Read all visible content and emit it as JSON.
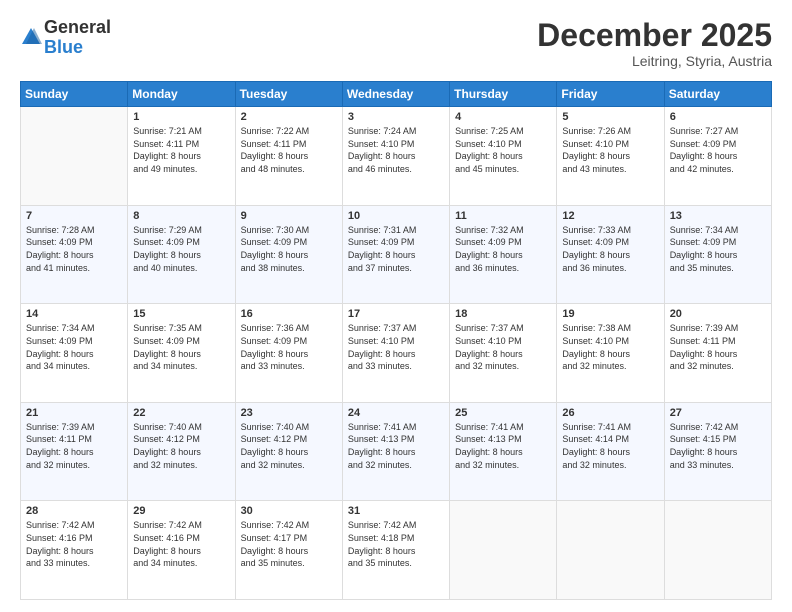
{
  "logo": {
    "general": "General",
    "blue": "Blue"
  },
  "header": {
    "month": "December 2025",
    "location": "Leitring, Styria, Austria"
  },
  "days_of_week": [
    "Sunday",
    "Monday",
    "Tuesday",
    "Wednesday",
    "Thursday",
    "Friday",
    "Saturday"
  ],
  "weeks": [
    [
      {
        "day": "",
        "info": ""
      },
      {
        "day": "1",
        "info": "Sunrise: 7:21 AM\nSunset: 4:11 PM\nDaylight: 8 hours\nand 49 minutes."
      },
      {
        "day": "2",
        "info": "Sunrise: 7:22 AM\nSunset: 4:11 PM\nDaylight: 8 hours\nand 48 minutes."
      },
      {
        "day": "3",
        "info": "Sunrise: 7:24 AM\nSunset: 4:10 PM\nDaylight: 8 hours\nand 46 minutes."
      },
      {
        "day": "4",
        "info": "Sunrise: 7:25 AM\nSunset: 4:10 PM\nDaylight: 8 hours\nand 45 minutes."
      },
      {
        "day": "5",
        "info": "Sunrise: 7:26 AM\nSunset: 4:10 PM\nDaylight: 8 hours\nand 43 minutes."
      },
      {
        "day": "6",
        "info": "Sunrise: 7:27 AM\nSunset: 4:09 PM\nDaylight: 8 hours\nand 42 minutes."
      }
    ],
    [
      {
        "day": "7",
        "info": "Sunrise: 7:28 AM\nSunset: 4:09 PM\nDaylight: 8 hours\nand 41 minutes."
      },
      {
        "day": "8",
        "info": "Sunrise: 7:29 AM\nSunset: 4:09 PM\nDaylight: 8 hours\nand 40 minutes."
      },
      {
        "day": "9",
        "info": "Sunrise: 7:30 AM\nSunset: 4:09 PM\nDaylight: 8 hours\nand 38 minutes."
      },
      {
        "day": "10",
        "info": "Sunrise: 7:31 AM\nSunset: 4:09 PM\nDaylight: 8 hours\nand 37 minutes."
      },
      {
        "day": "11",
        "info": "Sunrise: 7:32 AM\nSunset: 4:09 PM\nDaylight: 8 hours\nand 36 minutes."
      },
      {
        "day": "12",
        "info": "Sunrise: 7:33 AM\nSunset: 4:09 PM\nDaylight: 8 hours\nand 36 minutes."
      },
      {
        "day": "13",
        "info": "Sunrise: 7:34 AM\nSunset: 4:09 PM\nDaylight: 8 hours\nand 35 minutes."
      }
    ],
    [
      {
        "day": "14",
        "info": "Sunrise: 7:34 AM\nSunset: 4:09 PM\nDaylight: 8 hours\nand 34 minutes."
      },
      {
        "day": "15",
        "info": "Sunrise: 7:35 AM\nSunset: 4:09 PM\nDaylight: 8 hours\nand 34 minutes."
      },
      {
        "day": "16",
        "info": "Sunrise: 7:36 AM\nSunset: 4:09 PM\nDaylight: 8 hours\nand 33 minutes."
      },
      {
        "day": "17",
        "info": "Sunrise: 7:37 AM\nSunset: 4:10 PM\nDaylight: 8 hours\nand 33 minutes."
      },
      {
        "day": "18",
        "info": "Sunrise: 7:37 AM\nSunset: 4:10 PM\nDaylight: 8 hours\nand 32 minutes."
      },
      {
        "day": "19",
        "info": "Sunrise: 7:38 AM\nSunset: 4:10 PM\nDaylight: 8 hours\nand 32 minutes."
      },
      {
        "day": "20",
        "info": "Sunrise: 7:39 AM\nSunset: 4:11 PM\nDaylight: 8 hours\nand 32 minutes."
      }
    ],
    [
      {
        "day": "21",
        "info": "Sunrise: 7:39 AM\nSunset: 4:11 PM\nDaylight: 8 hours\nand 32 minutes."
      },
      {
        "day": "22",
        "info": "Sunrise: 7:40 AM\nSunset: 4:12 PM\nDaylight: 8 hours\nand 32 minutes."
      },
      {
        "day": "23",
        "info": "Sunrise: 7:40 AM\nSunset: 4:12 PM\nDaylight: 8 hours\nand 32 minutes."
      },
      {
        "day": "24",
        "info": "Sunrise: 7:41 AM\nSunset: 4:13 PM\nDaylight: 8 hours\nand 32 minutes."
      },
      {
        "day": "25",
        "info": "Sunrise: 7:41 AM\nSunset: 4:13 PM\nDaylight: 8 hours\nand 32 minutes."
      },
      {
        "day": "26",
        "info": "Sunrise: 7:41 AM\nSunset: 4:14 PM\nDaylight: 8 hours\nand 32 minutes."
      },
      {
        "day": "27",
        "info": "Sunrise: 7:42 AM\nSunset: 4:15 PM\nDaylight: 8 hours\nand 33 minutes."
      }
    ],
    [
      {
        "day": "28",
        "info": "Sunrise: 7:42 AM\nSunset: 4:16 PM\nDaylight: 8 hours\nand 33 minutes."
      },
      {
        "day": "29",
        "info": "Sunrise: 7:42 AM\nSunset: 4:16 PM\nDaylight: 8 hours\nand 34 minutes."
      },
      {
        "day": "30",
        "info": "Sunrise: 7:42 AM\nSunset: 4:17 PM\nDaylight: 8 hours\nand 35 minutes."
      },
      {
        "day": "31",
        "info": "Sunrise: 7:42 AM\nSunset: 4:18 PM\nDaylight: 8 hours\nand 35 minutes."
      },
      {
        "day": "",
        "info": ""
      },
      {
        "day": "",
        "info": ""
      },
      {
        "day": "",
        "info": ""
      }
    ]
  ]
}
